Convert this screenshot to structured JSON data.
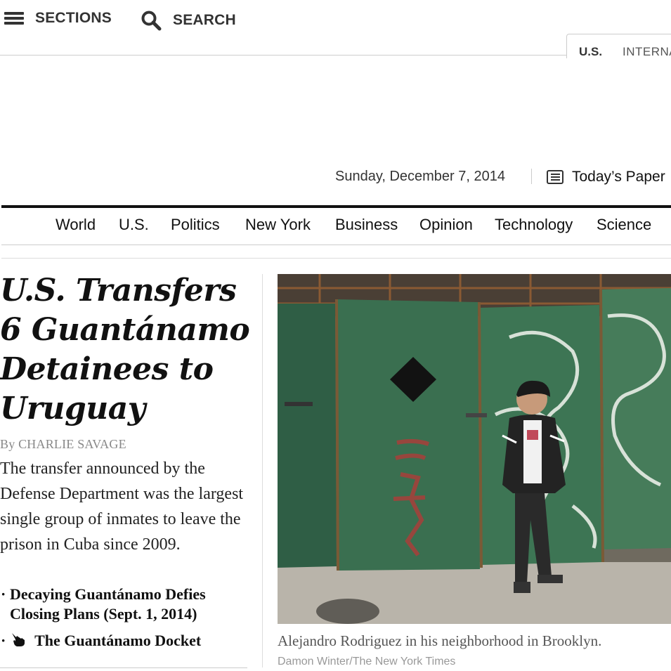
{
  "header": {
    "sections_label": "SECTIONS",
    "search_label": "SEARCH",
    "edition_tabs": [
      "U.S.",
      "INTERNA"
    ]
  },
  "dateline": {
    "date": "Sunday, December 7, 2014",
    "todays_paper": "Today’s Paper"
  },
  "nav": {
    "items": [
      "World",
      "U.S.",
      "Politics",
      "New York",
      "Business",
      "Opinion",
      "Technology",
      "Science"
    ]
  },
  "story": {
    "headline": "U.S. Transfers 6 Guantánamo Detainees to Uruguay",
    "byline": "By CHARLIE SAVAGE",
    "summary": "The transfer announced by the Defense Department was the largest single group of inmates to leave the prison in Cuba since 2009.",
    "related": [
      "Decaying Guantánamo Defies Closing Plans (Sept. 1, 2014)",
      "The Guantánamo Docket"
    ]
  },
  "photo": {
    "caption": "Alejandro Rodriguez in his neighborhood in Brooklyn.",
    "credit": "Damon Winter/The New York Times"
  }
}
